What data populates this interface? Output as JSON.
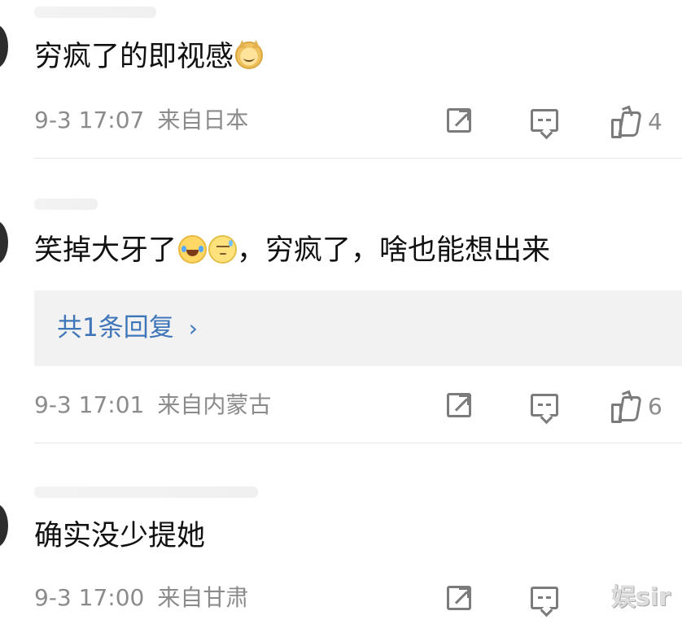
{
  "comments": [
    {
      "text": "穷疯了的即视感",
      "emoji": [
        "doge-emoji"
      ],
      "meta": {
        "time": "9-3 17:07",
        "location": "来自日本",
        "like_count": "4"
      }
    },
    {
      "text_before": "笑掉大牙了",
      "emoji": [
        "laugh-cry-emoji",
        "awkward-emoji"
      ],
      "text_after": "，穷疯了，啥也能想出来",
      "reply": "共1条回复",
      "reply_chevron": "›",
      "meta": {
        "time": "9-3 17:01",
        "location": "来自内蒙古",
        "like_count": "6"
      }
    },
    {
      "text": "确实没少提她",
      "meta": {
        "time": "9-3 17:00",
        "location": "来自甘肃"
      }
    }
  ],
  "watermark": "娱sir"
}
